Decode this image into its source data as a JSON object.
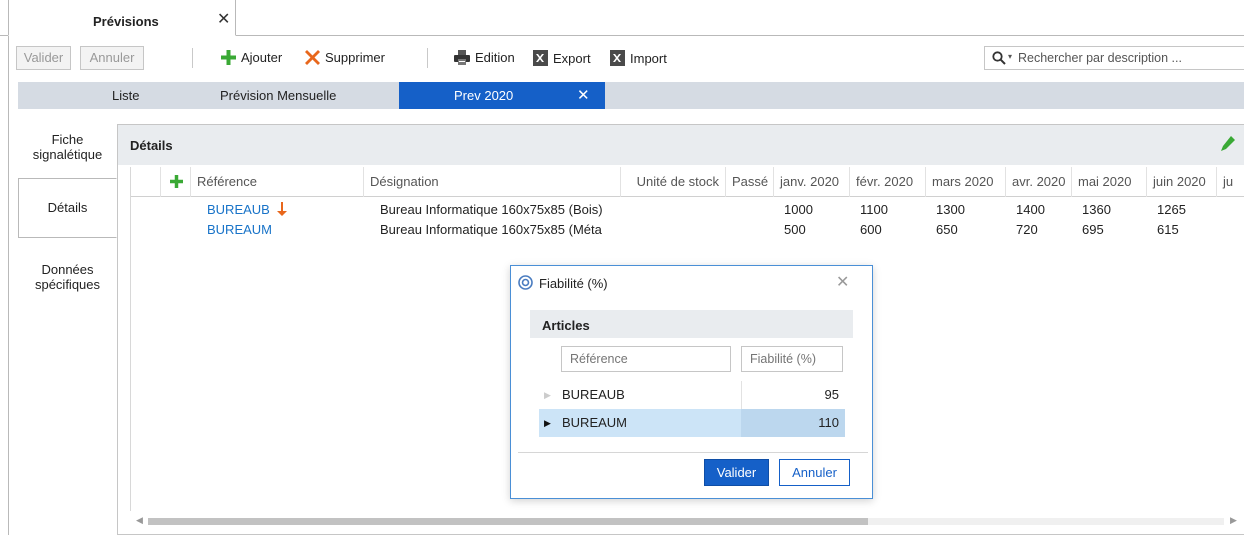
{
  "document_tab": {
    "title": "Prévisions",
    "close_glyph": "✕"
  },
  "toolbar": {
    "valider_label": "Valider",
    "annuler_label": "Annuler",
    "ajouter_label": "Ajouter",
    "supprimer_label": "Supprimer",
    "edition_label": "Edition",
    "export_label": "Export",
    "import_label": "Import",
    "search_placeholder": "Rechercher par description ...",
    "icons": {
      "add": "plus-icon",
      "delete": "x-icon",
      "print": "printer-icon",
      "export": "excel-export-icon",
      "import": "excel-import-icon",
      "search": "search-icon"
    },
    "colors": {
      "add": "#3aa935",
      "delete": "#e8671c"
    }
  },
  "view_tabs": {
    "liste": "Liste",
    "mensuelle": "Prévision Mensuelle",
    "active": "Prev 2020",
    "active_close": "✕",
    "active_color": "#1560c8"
  },
  "side_tabs": {
    "fiche_line1": "Fiche",
    "fiche_line2": "signalétique",
    "details": "Détails",
    "donnees_line1": "Données",
    "donnees_line2": "spécifiques"
  },
  "details": {
    "title": "Détails",
    "columns": {
      "add": "+",
      "reference": "Référence",
      "designation": "Désignation",
      "unite": "Unité de stock",
      "passe": "Passé",
      "m1": "janv. 2020",
      "m2": "févr. 2020",
      "m3": "mars 2020",
      "m4": "avr. 2020",
      "m5": "mai 2020",
      "m6": "juin 2020",
      "m7": "ju"
    },
    "rows": [
      {
        "reference": "BUREAUB",
        "designation": "Bureau Informatique 160x75x85 (Bois)",
        "m1": "1000",
        "m2": "1100",
        "m3": "1300",
        "m4": "1400",
        "m5": "1360",
        "m6": "1265"
      },
      {
        "reference": "BUREAUM",
        "designation": "Bureau Informatique 160x75x85 (Méta",
        "m1": "500",
        "m2": "600",
        "m3": "650",
        "m4": "720",
        "m5": "695",
        "m6": "615"
      }
    ],
    "link_color": "#1873c8",
    "sort_arrow_color": "#e8671c"
  },
  "dialog": {
    "title": "Fiabilité (%)",
    "section_title": "Articles",
    "filter_reference_placeholder": "Référence",
    "filter_fiabilite_placeholder": "Fiabilité (%)",
    "rows": [
      {
        "reference": "BUREAUB",
        "fiabilite": "95"
      },
      {
        "reference": "BUREAUM",
        "fiabilite": "110"
      }
    ],
    "selected_row_color": "#cce4f7",
    "valider_label": "Valider",
    "annuler_label": "Annuler",
    "close_glyph": "✕"
  }
}
